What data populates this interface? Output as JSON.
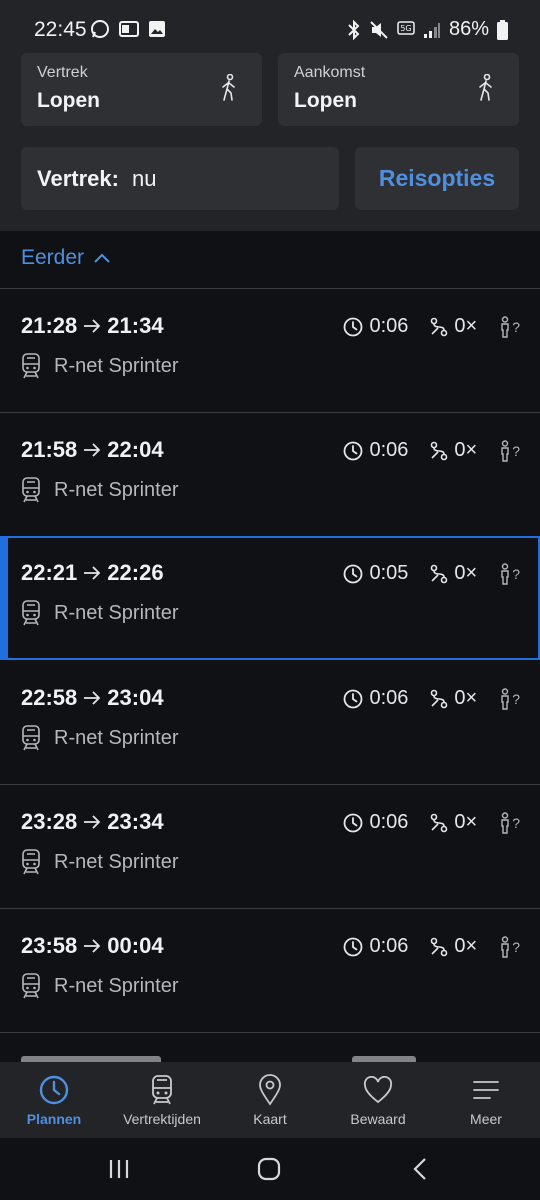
{
  "status": {
    "time": "22:45",
    "battery": "86%"
  },
  "from": {
    "label": "Vertrek",
    "value": "Lopen"
  },
  "to": {
    "label": "Aankomst",
    "value": "Lopen"
  },
  "departure": {
    "label": "Vertrek:",
    "value": "nu"
  },
  "options_label": "Reisopties",
  "earlier_label": "Eerder",
  "trips": [
    {
      "dep": "21:28",
      "arr": "21:34",
      "service": "R-net Sprinter",
      "duration": "0:06",
      "transfers": "0×",
      "crowd": "?"
    },
    {
      "dep": "21:58",
      "arr": "22:04",
      "service": "R-net Sprinter",
      "duration": "0:06",
      "transfers": "0×",
      "crowd": "?"
    },
    {
      "dep": "22:21",
      "arr": "22:26",
      "service": "R-net Sprinter",
      "duration": "0:05",
      "transfers": "0×",
      "crowd": "?"
    },
    {
      "dep": "22:58",
      "arr": "23:04",
      "service": "R-net Sprinter",
      "duration": "0:06",
      "transfers": "0×",
      "crowd": "?"
    },
    {
      "dep": "23:28",
      "arr": "23:34",
      "service": "R-net Sprinter",
      "duration": "0:06",
      "transfers": "0×",
      "crowd": "?"
    },
    {
      "dep": "23:58",
      "arr": "00:04",
      "service": "R-net Sprinter",
      "duration": "0:06",
      "transfers": "0×",
      "crowd": "?"
    }
  ],
  "selected_trip_index": 2,
  "nav": [
    {
      "label": "Plannen",
      "icon": "clock-icon",
      "active": true
    },
    {
      "label": "Vertrektijden",
      "icon": "train-icon"
    },
    {
      "label": "Kaart",
      "icon": "map-pin-icon"
    },
    {
      "label": "Bewaard",
      "icon": "heart-icon"
    },
    {
      "label": "Meer",
      "icon": "menu-icon"
    }
  ],
  "colors": {
    "accent": "#4f8fe0",
    "selected_border": "#1f6fe0",
    "background": "#101114",
    "panel": "#232427"
  }
}
